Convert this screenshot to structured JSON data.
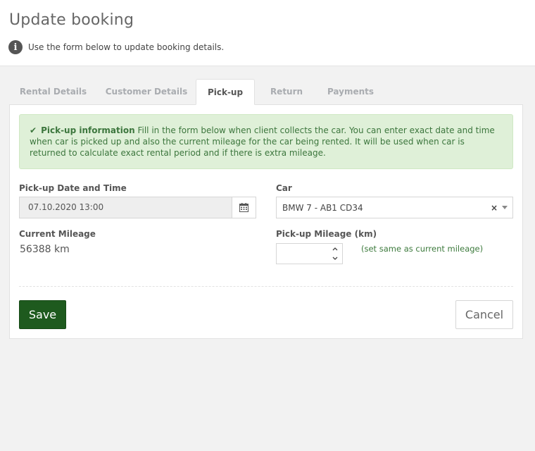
{
  "header": {
    "title": "Update booking",
    "subtitle": "Use the form below to update booking details."
  },
  "tabs": [
    {
      "label": "Rental Details",
      "active": false
    },
    {
      "label": "Customer Details",
      "active": false
    },
    {
      "label": "Pick-up",
      "active": true
    },
    {
      "label": "Return",
      "active": false
    },
    {
      "label": "Payments",
      "active": false
    }
  ],
  "alert": {
    "icon": "check-icon",
    "title": "Pick-up information",
    "text": "Fill in the form below when client collects the car. You can enter exact date and time when car is picked up and also the current mileage for the car being rented. It will be used when car is returned to calculate exact rental period and if there is extra mileage."
  },
  "form": {
    "pickup_date_label": "Pick-up Date and Time",
    "pickup_date_value": "07.10.2020 13:00",
    "car_label": "Car",
    "car_value": "BMW 7 - AB1 CD34",
    "current_mileage_label": "Current Mileage",
    "current_mileage_value": "56388 km",
    "pickup_mileage_label": "Pick-up Mileage (km)",
    "pickup_mileage_value": "",
    "same_as_link": "(set same as current mileage)"
  },
  "actions": {
    "save_label": "Save",
    "cancel_label": "Cancel"
  },
  "colors": {
    "accent": "#1e5a1e",
    "alert_bg": "#dff0d8",
    "alert_text": "#3c763d"
  }
}
